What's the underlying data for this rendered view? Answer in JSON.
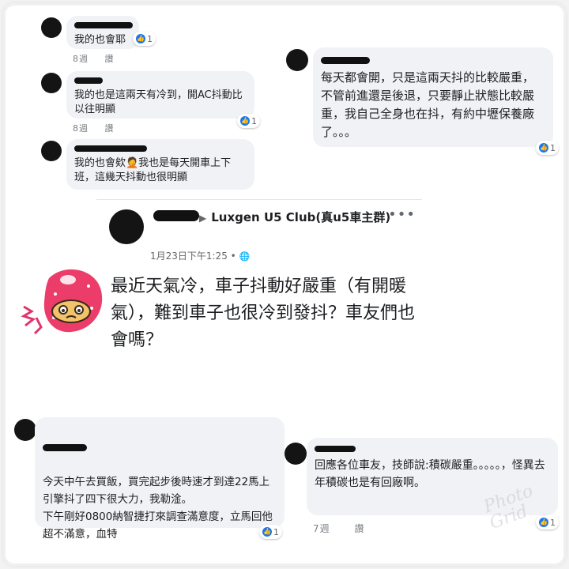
{
  "comments_left": [
    {
      "text": "我的也會耶",
      "likes": "1",
      "age": "8週",
      "action": "讚"
    },
    {
      "text": "我的也是這兩天有冷到，開AC抖動比以往明顯",
      "likes": "1",
      "age": "8週",
      "action": "讚"
    },
    {
      "text": "我的也會欸🤦我也是每天開車上下班，這幾天抖動也很明顯",
      "likes": ""
    }
  ],
  "comment_right_top": {
    "text": "每天都會開，只是這兩天抖的比較嚴重，不管前進還是後退，只要靜止狀態比較嚴重，我自己全身也在抖，有約中壢保養廠了。。。",
    "likes": "1"
  },
  "post": {
    "arrow": "▶",
    "group": "Luxgen U5 Club(真u5車主群)",
    "more": "•••",
    "time": "1月23日下午1:25 •",
    "globe": "🌐",
    "body": "最近天氣冷，車子抖動好嚴重（有開暖氣），難到車子也很冷到發抖？車友們也會嗎？"
  },
  "comment_bottom_left": {
    "text": "今天中午去買飯，買完起步後時速才到達22馬上引擎抖了四下很大力，我勒淦。\n下午剛好0800納智捷打來調查滿意度，立馬回他超不滿意，血特",
    "likes": "1"
  },
  "comment_bottom_right": {
    "text": "回應各位車友，技師說:積碳嚴重。。。。。，怪異去年積碳也是有回廠啊。",
    "likes": "1",
    "age": "7週",
    "action": "讚"
  },
  "watermark": "Photo Grid",
  "colors": {
    "like_blue": "#1877f2",
    "bubble_bg": "#f0f2f5"
  }
}
